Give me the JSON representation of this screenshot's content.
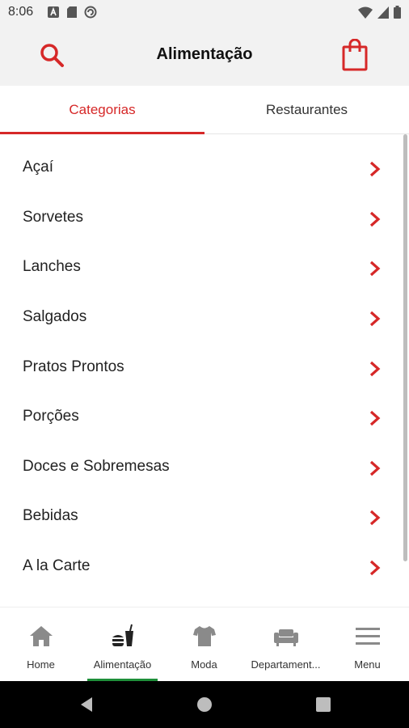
{
  "status_bar": {
    "time": "8:06"
  },
  "header": {
    "title": "Alimentação"
  },
  "tabs": [
    {
      "label": "Categorias",
      "active": true
    },
    {
      "label": "Restaurantes",
      "active": false
    }
  ],
  "categories": [
    {
      "label": "Açaí"
    },
    {
      "label": "Sorvetes"
    },
    {
      "label": "Lanches"
    },
    {
      "label": "Salgados"
    },
    {
      "label": "Pratos Prontos"
    },
    {
      "label": "Porções"
    },
    {
      "label": "Doces e Sobremesas"
    },
    {
      "label": "Bebidas"
    },
    {
      "label": "A la Carte"
    }
  ],
  "bottom_nav": [
    {
      "label": "Home",
      "icon": "home-icon"
    },
    {
      "label": "Alimentação",
      "icon": "food-drink-icon",
      "active": true
    },
    {
      "label": "Moda",
      "icon": "tshirt-icon"
    },
    {
      "label": "Departament...",
      "icon": "sofa-icon"
    },
    {
      "label": "Menu",
      "icon": "hamburger-menu-icon"
    }
  ],
  "colors": {
    "accent": "#d62828",
    "active_nav": "#1f8f3a",
    "header_bg": "#f2f2f2"
  }
}
